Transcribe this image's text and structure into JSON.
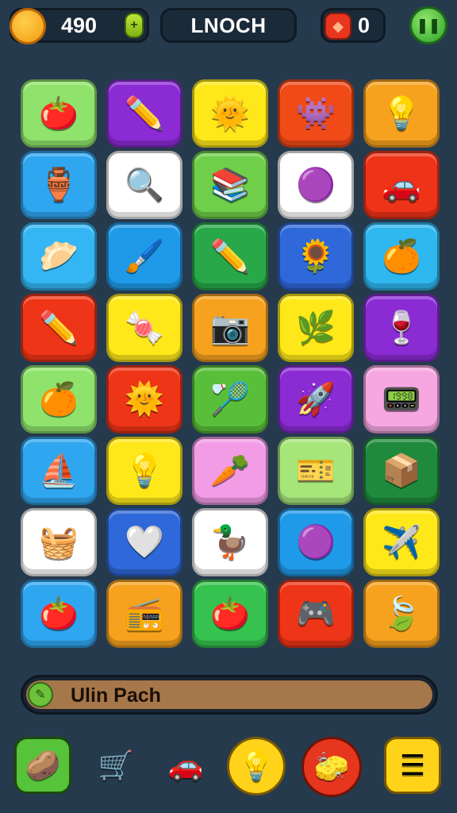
{
  "hud": {
    "coins_value": "490",
    "title": "LNOCH",
    "gems_value": "0",
    "icons": {
      "coins": "smiley-face-icon",
      "coins_add": "plus-icon",
      "gems": "red-gem-icon",
      "pause": "pause-icon"
    }
  },
  "grid": {
    "tiles": [
      {
        "icon": "tomato-face-icon",
        "glyph": "🍅",
        "color": "#8fe36c"
      },
      {
        "icon": "pencil-icon",
        "glyph": "✏️",
        "color": "#8a2bd4"
      },
      {
        "icon": "sun-face-icon",
        "glyph": "🌞",
        "color": "#ffe81a"
      },
      {
        "icon": "purple-creature-icon",
        "glyph": "👾",
        "color": "#f04a17"
      },
      {
        "icon": "bulb-icon",
        "glyph": "💡",
        "color": "#f6a21e"
      },
      {
        "icon": "jar-icon",
        "glyph": "🏺",
        "color": "#2fa6f0"
      },
      {
        "icon": "magnifier-icon",
        "glyph": "🔍",
        "color": "#ffffff"
      },
      {
        "icon": "books-icon",
        "glyph": "📚",
        "color": "#6fcf4a"
      },
      {
        "icon": "purple-face-icon",
        "glyph": "🟣",
        "color": "#ffffff"
      },
      {
        "icon": "toy-car-icon",
        "glyph": "🚗",
        "color": "#ee3318"
      },
      {
        "icon": "yellow-bun-face-icon",
        "glyph": "🥟",
        "color": "#34b6f4"
      },
      {
        "icon": "brush-icon",
        "glyph": "🖌️",
        "color": "#1f9ae8"
      },
      {
        "icon": "pencil-icon",
        "glyph": "✏️",
        "color": "#29a84a"
      },
      {
        "icon": "sunflower-face-icon",
        "glyph": "🌻",
        "color": "#2f68d8"
      },
      {
        "icon": "orange-face-icon",
        "glyph": "🍊",
        "color": "#2fb7ef"
      },
      {
        "icon": "pencil-icon",
        "glyph": "✏️",
        "color": "#ee3517"
      },
      {
        "icon": "candy-icon",
        "glyph": "🍬",
        "color": "#ffe81a"
      },
      {
        "icon": "camera-icon",
        "glyph": "📷",
        "color": "#f6a21e"
      },
      {
        "icon": "leaf-icon",
        "glyph": "🌿",
        "color": "#ffe81a"
      },
      {
        "icon": "wine-glass-icon",
        "glyph": "🍷",
        "color": "#8a2bd4"
      },
      {
        "icon": "orange-icon",
        "glyph": "🍊",
        "color": "#8fe36c"
      },
      {
        "icon": "sun-face-icon",
        "glyph": "🌞",
        "color": "#ee3517"
      },
      {
        "icon": "racket-icon",
        "glyph": "🏸",
        "color": "#59bf3a"
      },
      {
        "icon": "rocket-icon",
        "glyph": "🚀",
        "color": "#8a2bd4"
      },
      {
        "icon": "tablet-icon",
        "glyph": "📟",
        "color": "#f6a7e2"
      },
      {
        "icon": "sailboat-icon",
        "glyph": "⛵",
        "color": "#2fa6f0"
      },
      {
        "icon": "lightbulb-icon",
        "glyph": "💡",
        "color": "#ffe81a"
      },
      {
        "icon": "carrot-icon",
        "glyph": "🥕",
        "color": "#f29ce6"
      },
      {
        "icon": "ticket-icon",
        "glyph": "🎫",
        "color": "#a6e57a"
      },
      {
        "icon": "box-icon",
        "glyph": "📦",
        "color": "#1f8a3c"
      },
      {
        "icon": "basket-icon",
        "glyph": "🧺",
        "color": "#ffffff"
      },
      {
        "icon": "heart-icon",
        "glyph": "🤍",
        "color": "#2f68d8"
      },
      {
        "icon": "duck-icon",
        "glyph": "🦆",
        "color": "#ffffff"
      },
      {
        "icon": "purple-smiley-icon",
        "glyph": "🟣",
        "color": "#1f9ae8"
      },
      {
        "icon": "plane-icon",
        "glyph": "✈️",
        "color": "#ffe81a"
      },
      {
        "icon": "tomato-face-icon",
        "glyph": "🍅",
        "color": "#2fa6f0"
      },
      {
        "icon": "radio-icon",
        "glyph": "📻",
        "color": "#f6a21e"
      },
      {
        "icon": "tomato-face-icon",
        "glyph": "🍅",
        "color": "#36c24e"
      },
      {
        "icon": "gamepad-icon",
        "glyph": "🎮",
        "color": "#ee3517"
      },
      {
        "icon": "leaf-ornament-icon",
        "glyph": "🍃",
        "color": "#f6a21e"
      }
    ]
  },
  "progress": {
    "label": "Ulin Pach",
    "icon": "pencil-icon",
    "bar_color": "#a6774a"
  },
  "toolbar": {
    "items": [
      {
        "icon": "potato-character-icon",
        "glyph": "🥔"
      },
      {
        "icon": "lawnmower-icon",
        "glyph": "🛒"
      },
      {
        "icon": "car-icon",
        "glyph": "🚗"
      },
      {
        "icon": "bulb-icon",
        "glyph": "💡"
      },
      {
        "icon": "eraser-icon",
        "glyph": "🧽"
      },
      {
        "icon": "menu-icon",
        "glyph": "☰"
      }
    ]
  }
}
